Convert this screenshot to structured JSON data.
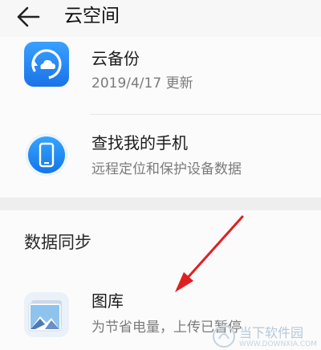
{
  "header": {
    "title": "云空间"
  },
  "items": [
    {
      "title": "云备份",
      "subtitle": "2019/4/17 更新",
      "icon": "cloud-backup-icon"
    },
    {
      "title": "查找我的手机",
      "subtitle": "远程定位和保护设备数据",
      "icon": "find-phone-icon"
    }
  ],
  "sync": {
    "section_title": "数据同步",
    "items": [
      {
        "title": "图库",
        "subtitle": "为节省电量，上传已暂停",
        "icon": "gallery-icon"
      }
    ]
  },
  "watermark": {
    "text": "当下软件园",
    "sub": "WWW.DOWNXIA.COM"
  },
  "colors": {
    "accent_blue": "#1e88ff",
    "annotation_red": "#e02020"
  }
}
